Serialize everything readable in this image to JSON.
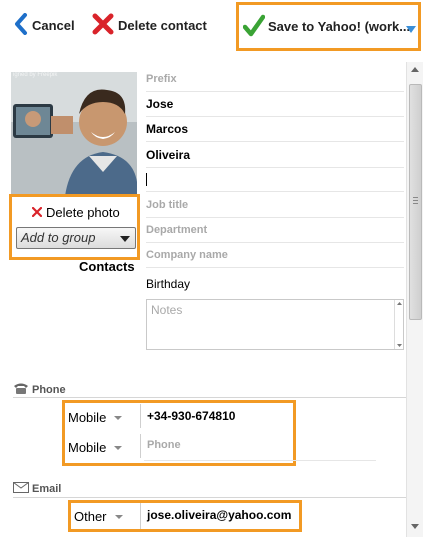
{
  "toolbar": {
    "cancel_label": "Cancel",
    "delete_label": "Delete contact",
    "save_label": "Save to Yahoo! (work..."
  },
  "photo": {
    "watermark": "igned by Freepik"
  },
  "left_panel": {
    "delete_photo_label": "Delete photo",
    "group_placeholder": "Add to group",
    "contacts_label": "Contacts"
  },
  "fields": {
    "prefix": "Prefix",
    "first_name": "Jose",
    "middle_name": "Marcos",
    "last_name": "Oliveira",
    "job_title": "Job title",
    "department": "Department",
    "company": "Company name",
    "birthday": "Birthday",
    "notes": "Notes"
  },
  "phone": {
    "section_label": "Phone",
    "rows": [
      {
        "type": "Mobile",
        "value": "+34-930-674810"
      },
      {
        "type": "Mobile",
        "placeholder": "Phone"
      }
    ]
  },
  "email": {
    "section_label": "Email",
    "rows": [
      {
        "type": "Other",
        "value": "jose.oliveira@yahoo.com"
      }
    ]
  },
  "colors": {
    "highlight": "#f29a24",
    "back_arrow": "#1e6fc9",
    "delete_x": "#d9232a",
    "save_check": "#3aa335",
    "dropdown_arrow": "#3b8fd8"
  }
}
